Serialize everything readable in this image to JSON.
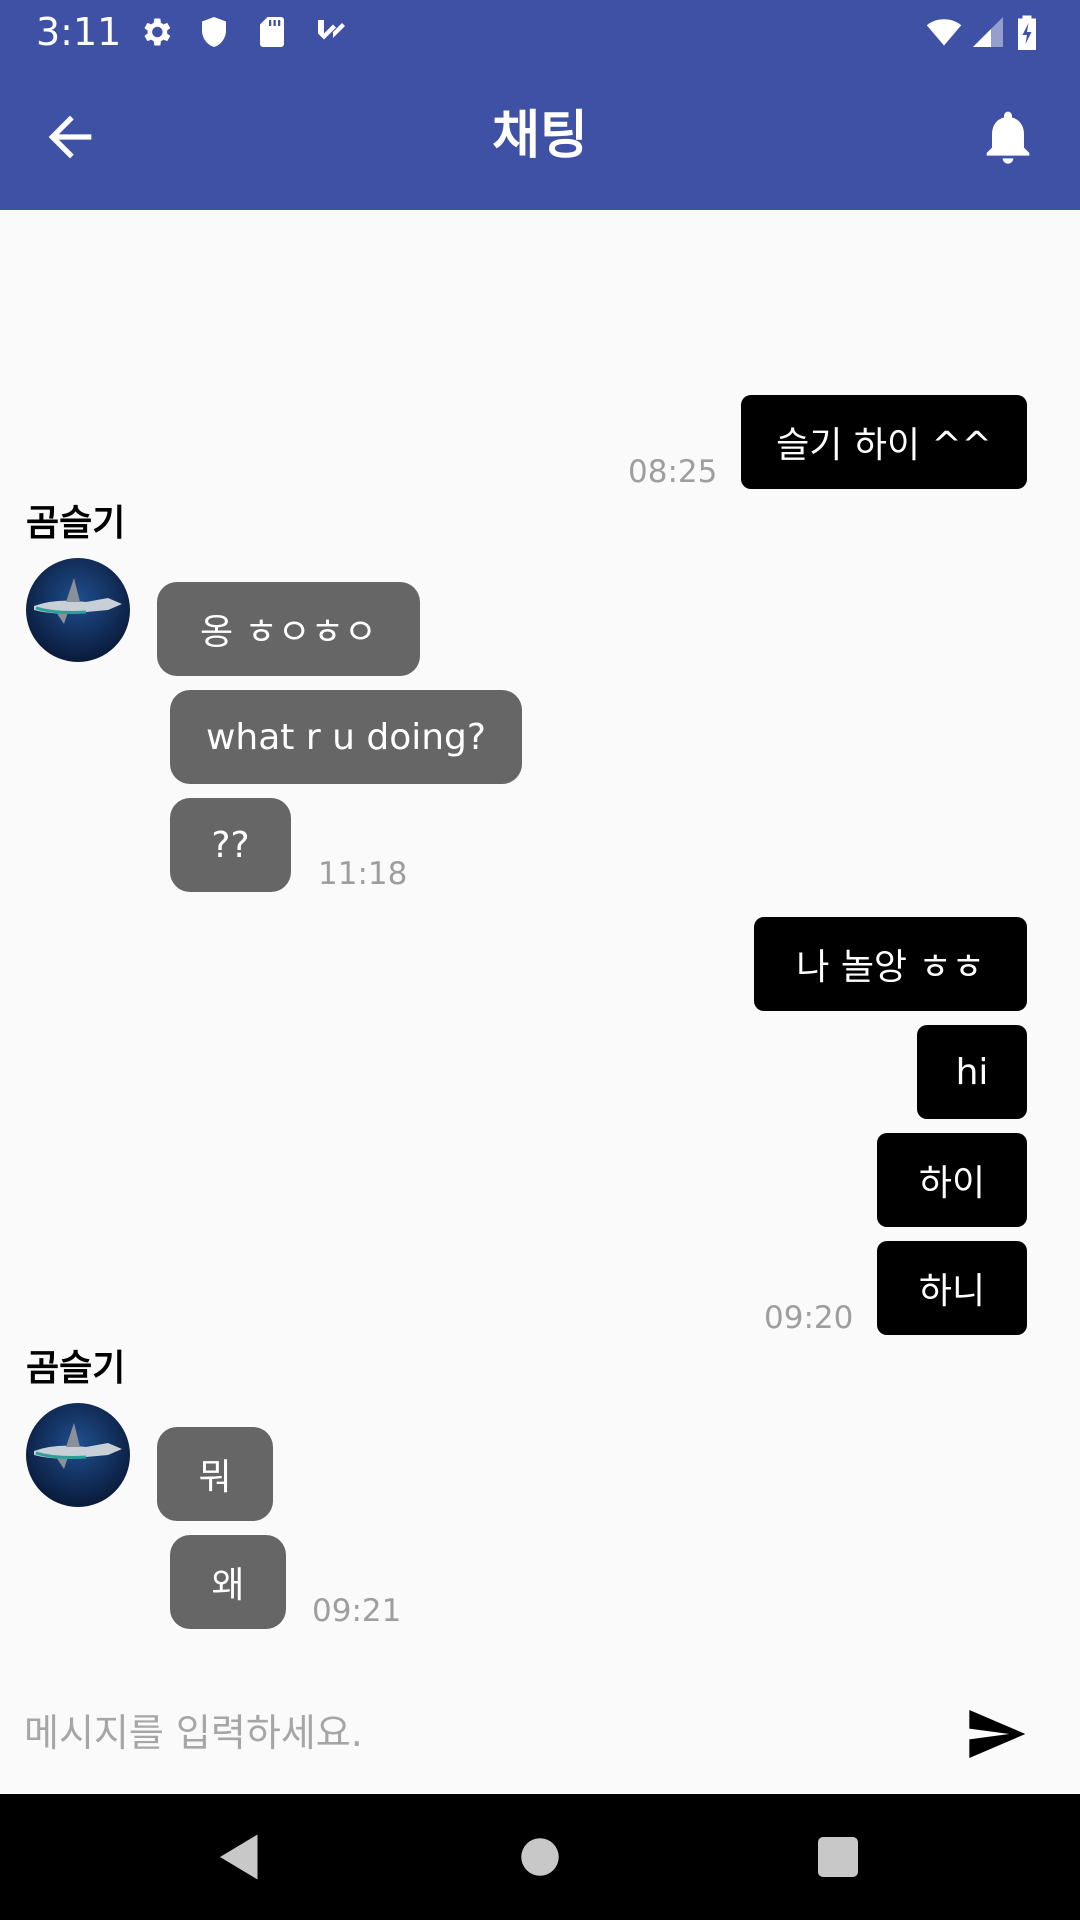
{
  "status_bar": {
    "time": "3:11",
    "left_icons": [
      "settings-icon",
      "shield-icon",
      "sd-card-icon",
      "task-check-icon"
    ],
    "right_icons": [
      "wifi-icon",
      "signal-icon",
      "battery-charging-icon"
    ],
    "background": "#3f51a5"
  },
  "app_bar": {
    "title": "채팅",
    "back_icon": "arrow-back-icon",
    "action_icon": "bell-icon",
    "background": "#3f51a5"
  },
  "colors": {
    "my_bubble": "#000000",
    "their_bubble": "#666666",
    "timestamp": "#9e9e9e",
    "placeholder": "#a6a6a6"
  },
  "messages": {
    "group1": {
      "items": [
        "슬기 하이 ^^"
      ],
      "time": "08:25"
    },
    "group2": {
      "sender": "곰슬기",
      "items": [
        "옹 ㅎㅇㅎㅇ",
        "what r u doing?",
        "??"
      ],
      "time": "11:18"
    },
    "group3": {
      "items": [
        "나 놀앙 ㅎㅎ",
        "hi",
        "하이",
        "하니"
      ],
      "time": "09:20"
    },
    "group4": {
      "sender": "곰슬기",
      "items": [
        "뭐",
        "왜"
      ],
      "time": "09:21"
    }
  },
  "composer": {
    "placeholder": "메시지를 입력하세요.",
    "value": "",
    "send_icon": "send-icon"
  },
  "nav_bar": {
    "icons": [
      "back-triangle-icon",
      "home-circle-icon",
      "recents-square-icon"
    ]
  }
}
